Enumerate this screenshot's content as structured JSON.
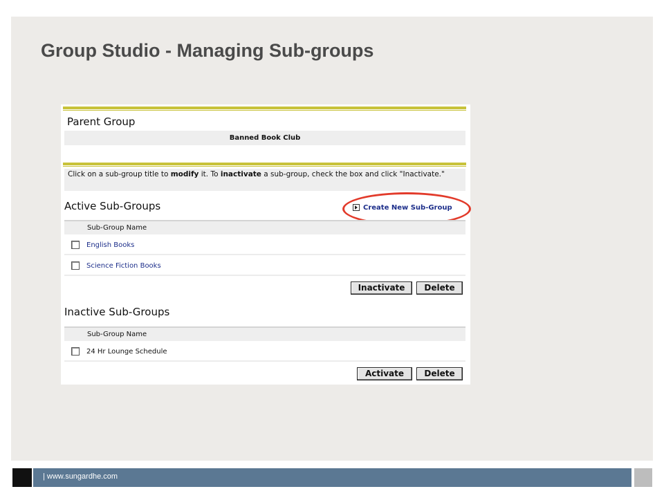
{
  "slide": {
    "title": "Group Studio - Managing Sub-groups"
  },
  "panel": {
    "parent_group_label": "Parent Group",
    "parent_group_name": "Banned Book Club",
    "instructions": {
      "part1": "Click on a sub-group title to ",
      "modify": "modify",
      "part2": " it. To ",
      "inactivate": "inactivate",
      "part3": " a sub-group, check the box and click \"Inactivate.\""
    },
    "active": {
      "heading": "Active Sub-Groups",
      "create_link": "Create New Sub-Group",
      "column_header": "Sub-Group Name",
      "rows": [
        "English Books",
        "Science Fiction Books"
      ],
      "inactivate_button": "Inactivate",
      "delete_button": "Delete"
    },
    "inactive": {
      "heading": "Inactive Sub-Groups",
      "column_header": "Sub-Group Name",
      "rows": [
        "24 Hr Lounge Schedule"
      ],
      "activate_button": "Activate",
      "delete_button": "Delete"
    }
  },
  "footer": {
    "text": "| www.sungardhe.com"
  },
  "colors": {
    "accent_rule": "#c8c23a",
    "highlight": "#e23a2a",
    "link": "#1c2e8a",
    "footer": "#5b7893"
  }
}
